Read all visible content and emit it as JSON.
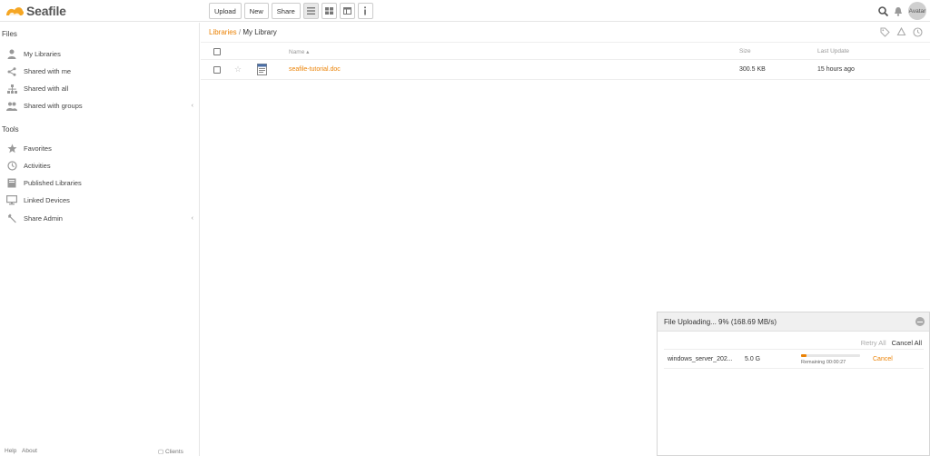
{
  "app": {
    "name": "Seafile",
    "brand_color": "#eb8205"
  },
  "toolbar": {
    "upload": "Upload",
    "new": "New",
    "share": "Share",
    "view_icons": [
      "list-view-icon",
      "grid-view-icon",
      "column-view-icon",
      "info-icon"
    ]
  },
  "header_right": {
    "search_icon": "search-icon",
    "bell_icon": "bell-icon",
    "avatar": "Avatar"
  },
  "sidebar": {
    "files_heading": "Files",
    "files_items": [
      {
        "label": "My Libraries",
        "icon": "user-icon"
      },
      {
        "label": "Shared with me",
        "icon": "share-icon"
      },
      {
        "label": "Shared with all",
        "icon": "org-icon"
      },
      {
        "label": "Shared with groups",
        "icon": "group-icon"
      }
    ],
    "tools_heading": "Tools",
    "tools_items": [
      {
        "label": "Favorites",
        "icon": "star-icon"
      },
      {
        "label": "Activities",
        "icon": "clock-icon"
      },
      {
        "label": "Published Libraries",
        "icon": "book-icon"
      },
      {
        "label": "Linked Devices",
        "icon": "monitor-icon"
      },
      {
        "label": "Share Admin",
        "icon": "wrench-icon"
      }
    ],
    "footer": {
      "help": "Help",
      "about": "About",
      "clients": "Clients"
    }
  },
  "breadcrumb": {
    "root": "Libraries",
    "separator": "/",
    "current": "My Library"
  },
  "table": {
    "headers": {
      "name": "Name",
      "size": "Size",
      "last_update": "Last Update"
    },
    "rows": [
      {
        "name": "seafile-tutorial.doc",
        "size": "300.5 KB",
        "last_update": "15 hours ago"
      }
    ]
  },
  "upload_dialog": {
    "title": "File Uploading... 9% (168.69 MB/s)",
    "retry_all": "Retry All",
    "cancel_all": "Cancel All",
    "items": [
      {
        "name": "windows_server_202...",
        "size": "5.0 G",
        "progress": 0.09,
        "remaining": "Remaining 00:00:27",
        "cancel": "Cancel"
      }
    ]
  }
}
